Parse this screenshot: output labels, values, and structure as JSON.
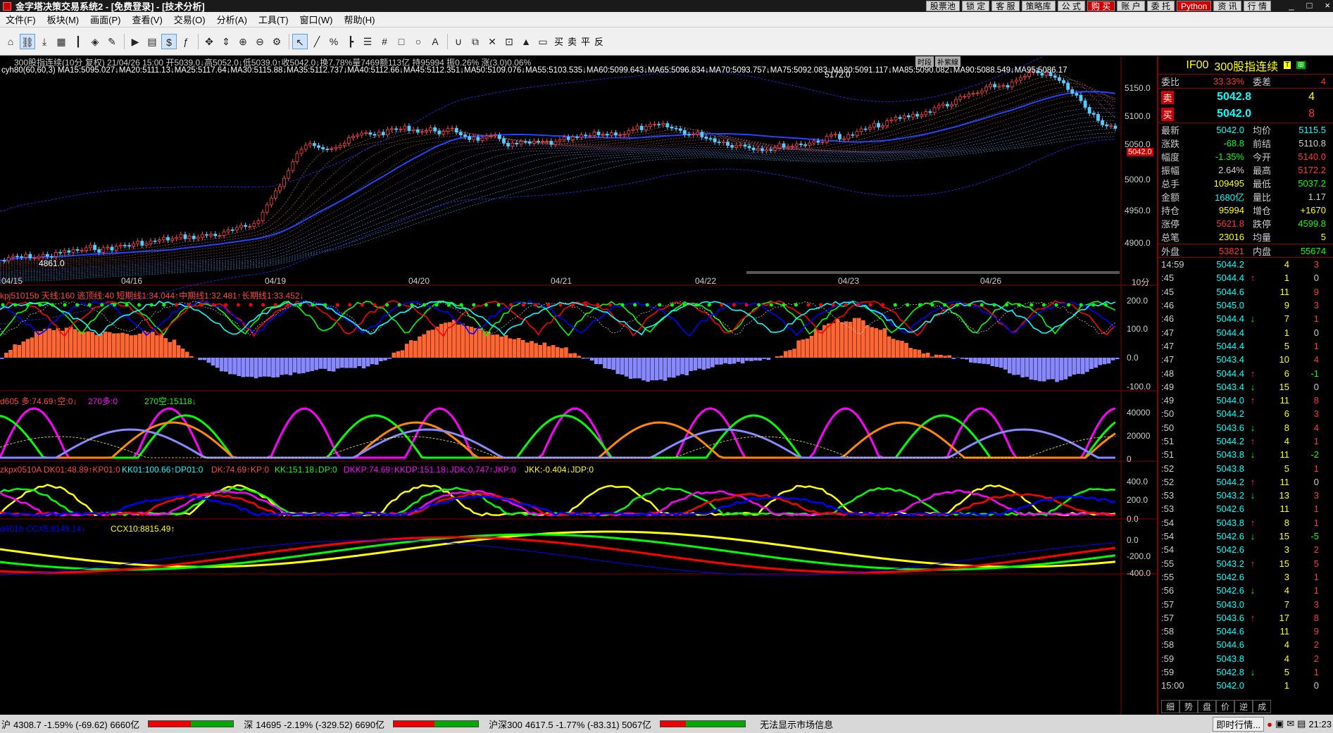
{
  "app": {
    "title": "金字塔决策交易系统2 - [免费登录] - [技术分析]",
    "top_buttons": [
      "股票池",
      "锁 定",
      "客 服",
      "策略库",
      "公 式",
      "购 买",
      "账 户",
      "委 托",
      "Python",
      "资 讯",
      "行 情"
    ],
    "window_controls": [
      "_",
      "□",
      "×"
    ]
  },
  "menu": [
    "文件(F)",
    "板块(M)",
    "画面(P)",
    "查看(V)",
    "交易(O)",
    "分析(A)",
    "工具(T)",
    "窗口(W)",
    "帮助(H)"
  ],
  "toolbar": {
    "icons": [
      "home-icon",
      "link-icon",
      "download-icon",
      "grid-icon",
      "bar-chart-icon",
      "indicator-icon",
      "edit-icon",
      "play-icon",
      "notebook-icon",
      "dollar-icon",
      "formula-icon",
      "move-icon",
      "cursor-vertical-icon",
      "zoom-in-icon",
      "zoom-out-icon",
      "settings-icon",
      "pointer-icon",
      "line-icon",
      "percent-icon",
      "ruler-icon",
      "hlines-icon",
      "grid-draw-icon",
      "rect-icon",
      "ellipse-icon",
      "text-icon",
      "magnet-icon",
      "copy-icon",
      "delete-icon",
      "lock-icon",
      "color-icon",
      "save-icon"
    ],
    "trade_labels": [
      "买",
      "卖",
      "平",
      "反"
    ]
  },
  "chart": {
    "info_line1": "300股指连续(10分 复权) 21/04/26 15:00 开5039.0↓高5052.0↓低5039.0↑收5042.0↓换7.78%量7469额113亿 持95994 振0.26% 涨(3.0)0.06%",
    "info_line2": "cyh80(60,60,3) MA15:5095.027↓MA20:5111.13↓MA25:5117.64↓MA30:5115.88↓MA35:5112.737↓MA40:5112.66↓MA45:5112.351↓MA50:5109.076↓MA55:5103.535↓MA60:5099.643↓MA65:5096.834↓MA70:5093.757↓MA75:5092.083↓MA80:5091.117↓MA85:5090.082↓MA90:5088.549↓MA95:5086.17",
    "right_tags": [
      "时段",
      "补紫線"
    ],
    "price_axis": [
      "5150.0",
      "5100.0",
      "5050.0",
      "5000.0",
      "4950.0",
      "4900.0"
    ],
    "current_price_tag": "5042.0",
    "high_label": "5172.0",
    "low_label": "4861.0",
    "date_axis": [
      "04/15",
      "04/16",
      "04/19",
      "04/20",
      "04/21",
      "04/22",
      "04/23",
      "04/26"
    ],
    "period_label": "10分",
    "panel2": {
      "title": "kpj51015b 天线:160 逃顶线:40 短期线1:34.044↑中期线1:32.481↑长期线1:33.452↓",
      "axis": [
        "200.0",
        "100.0",
        "0.0",
        "-100.0"
      ]
    },
    "panel3": {
      "title_a": "d605 多:74.69↑空:0↓",
      "title_b": "270多:0",
      "title_c": "270空:15118↓",
      "axis": [
        "40000",
        "20000",
        "0"
      ]
    },
    "panel4": {
      "title_a": "zkpx0510A DK01:48.89↑KP01:0",
      "title_b": "KK01:100.66↑DP01:0",
      "title_c": "DK:74.69↑KP:0",
      "title_d": "KK:151.18↓DP:0",
      "title_e": "DKKP:74.69↑KKDP:151.18↓JDK:0.747↑JKP:0",
      "title_f": "JKK:-0.404↓JDP:0",
      "axis": [
        "400.0",
        "200.0",
        "0.0"
      ]
    },
    "panel5": {
      "title_a": "d601b CCX5:8149.14↓",
      "title_b": "CCX10:8815.49↑",
      "axis": [
        "0.0",
        "-200.0",
        "-400.0"
      ]
    }
  },
  "quote": {
    "code": "IF00",
    "name": "300股指连续",
    "weibi_label": "委比",
    "weibi": "33.33%",
    "weicha_label": "委差",
    "weicha": "4",
    "sell_label": "卖",
    "sell_price": "5042.8",
    "sell_vol": "4",
    "buy_label": "买",
    "buy_price": "5042.0",
    "buy_vol": "8",
    "rows": [
      {
        "l1": "最新",
        "v1": "5042.0",
        "l2": "均价",
        "v2": "5115.5",
        "c1": "#0ff",
        "c2": "#0ff"
      },
      {
        "l1": "涨跌",
        "v1": "-68.8",
        "l2": "前结",
        "v2": "5110.8",
        "c1": "#0f0",
        "c2": "#ccc"
      },
      {
        "l1": "幅度",
        "v1": "-1.35%",
        "l2": "今开",
        "v2": "5140.0",
        "c1": "#0f0",
        "c2": "#f33"
      },
      {
        "l1": "振幅",
        "v1": "2.64%",
        "l2": "最高",
        "v2": "5172.2",
        "c1": "#ccc",
        "c2": "#f33"
      },
      {
        "l1": "总手",
        "v1": "109495",
        "l2": "最低",
        "v2": "5037.2",
        "c1": "#ff0",
        "c2": "#0f0"
      },
      {
        "l1": "金额",
        "v1": "1680亿",
        "l2": "量比",
        "v2": "1.17",
        "c1": "#0ff",
        "c2": "#ccc"
      },
      {
        "l1": "持仓",
        "v1": "95994",
        "l2": "增仓",
        "v2": "+1670",
        "c1": "#ff0",
        "c2": "#ff0"
      },
      {
        "l1": "涨停",
        "v1": "5621.8",
        "l2": "跌停",
        "v2": "4599.8",
        "c1": "#f33",
        "c2": "#0f0"
      },
      {
        "l1": "总笔",
        "v1": "23016",
        "l2": "均量",
        "v2": "5",
        "c1": "#ff0",
        "c2": "#ff0"
      },
      {
        "l1": "外盘",
        "v1": "53821",
        "l2": "内盘",
        "v2": "55674",
        "c1": "#f33",
        "c2": "#0f0"
      }
    ],
    "ticks": [
      {
        "t": "14:59",
        "p": "5044.2",
        "a": "",
        "v": "4",
        "c": "3",
        "cc": "#f33"
      },
      {
        "t": ":45",
        "p": "5044.4",
        "a": "↑",
        "v": "1",
        "c": "0",
        "cc": "#ccc"
      },
      {
        "t": ":45",
        "p": "5044.6",
        "a": "",
        "v": "11",
        "c": "9",
        "cc": "#f33"
      },
      {
        "t": ":46",
        "p": "5045.0",
        "a": "",
        "v": "9",
        "c": "3",
        "cc": "#f33"
      },
      {
        "t": ":46",
        "p": "5044.4",
        "a": "↓",
        "v": "7",
        "c": "1",
        "cc": "#f33"
      },
      {
        "t": ":47",
        "p": "5044.4",
        "a": "",
        "v": "1",
        "c": "0",
        "cc": "#ccc"
      },
      {
        "t": ":47",
        "p": "5044.4",
        "a": "",
        "v": "5",
        "c": "1",
        "cc": "#f33"
      },
      {
        "t": ":47",
        "p": "5043.4",
        "a": "",
        "v": "10",
        "c": "4",
        "cc": "#f33"
      },
      {
        "t": ":48",
        "p": "5044.4",
        "a": "↑",
        "v": "6",
        "c": "-1",
        "cc": "#0f0"
      },
      {
        "t": ":49",
        "p": "5043.4",
        "a": "↓",
        "v": "15",
        "c": "0",
        "cc": "#ccc"
      },
      {
        "t": ":49",
        "p": "5044.0",
        "a": "↑",
        "v": "11",
        "c": "8",
        "cc": "#f33"
      },
      {
        "t": ":50",
        "p": "5044.2",
        "a": "",
        "v": "6",
        "c": "3",
        "cc": "#f33"
      },
      {
        "t": ":50",
        "p": "5043.6",
        "a": "↓",
        "v": "8",
        "c": "4",
        "cc": "#f33"
      },
      {
        "t": ":51",
        "p": "5044.2",
        "a": "↑",
        "v": "4",
        "c": "1",
        "cc": "#f33"
      },
      {
        "t": ":51",
        "p": "5043.8",
        "a": "↓",
        "v": "11",
        "c": "-2",
        "cc": "#0f0"
      },
      {
        "t": ":52",
        "p": "5043.8",
        "a": "",
        "v": "5",
        "c": "1",
        "cc": "#f33"
      },
      {
        "t": ":52",
        "p": "5044.2",
        "a": "↑",
        "v": "11",
        "c": "0",
        "cc": "#ccc"
      },
      {
        "t": ":53",
        "p": "5043.2",
        "a": "↓",
        "v": "13",
        "c": "3",
        "cc": "#f33"
      },
      {
        "t": ":53",
        "p": "5042.6",
        "a": "",
        "v": "11",
        "c": "1",
        "cc": "#f33"
      },
      {
        "t": ":54",
        "p": "5043.8",
        "a": "↑",
        "v": "8",
        "c": "1",
        "cc": "#f33"
      },
      {
        "t": ":54",
        "p": "5042.6",
        "a": "↓",
        "v": "15",
        "c": "-5",
        "cc": "#0f0"
      },
      {
        "t": ":54",
        "p": "5042.6",
        "a": "",
        "v": "3",
        "c": "2",
        "cc": "#f33"
      },
      {
        "t": ":55",
        "p": "5043.2",
        "a": "↑",
        "v": "15",
        "c": "5",
        "cc": "#f33"
      },
      {
        "t": ":55",
        "p": "5042.6",
        "a": "",
        "v": "3",
        "c": "1",
        "cc": "#f33"
      },
      {
        "t": ":56",
        "p": "5042.6",
        "a": "↓",
        "v": "4",
        "c": "1",
        "cc": "#f33"
      },
      {
        "t": ":57",
        "p": "5043.0",
        "a": "",
        "v": "7",
        "c": "3",
        "cc": "#f33"
      },
      {
        "t": ":57",
        "p": "5043.6",
        "a": "↑",
        "v": "17",
        "c": "8",
        "cc": "#f33"
      },
      {
        "t": ":58",
        "p": "5044.6",
        "a": "",
        "v": "11",
        "c": "9",
        "cc": "#f33"
      },
      {
        "t": ":58",
        "p": "5044.6",
        "a": "",
        "v": "4",
        "c": "2",
        "cc": "#f33"
      },
      {
        "t": ":59",
        "p": "5043.8",
        "a": "",
        "v": "4",
        "c": "2",
        "cc": "#f33"
      },
      {
        "t": ":59",
        "p": "5042.8",
        "a": "↓",
        "v": "5",
        "c": "1",
        "cc": "#f33"
      },
      {
        "t": "15:00",
        "p": "5042.0",
        "a": "",
        "v": "1",
        "c": "0",
        "cc": "#ccc"
      }
    ],
    "tabs": [
      "细",
      "势",
      "盘",
      "价",
      "逆",
      "成"
    ]
  },
  "status": {
    "sh": "沪",
    "sh_val": "4308.7 -1.59% (-69.62) 6660亿",
    "sz": "深",
    "sz_val": "14695 -2.19% (-329.52) 6690亿",
    "hs": "沪深300",
    "hs_val": "4617.5 -1.77% (-83.31) 5067亿",
    "msg": "无法显示市场信息",
    "realtime": "即时行情...",
    "clock": "21:23"
  },
  "colors": {
    "up": "#ff3333",
    "down": "#00ff00",
    "axis_red": "#800000",
    "accent": "#ffff00"
  }
}
